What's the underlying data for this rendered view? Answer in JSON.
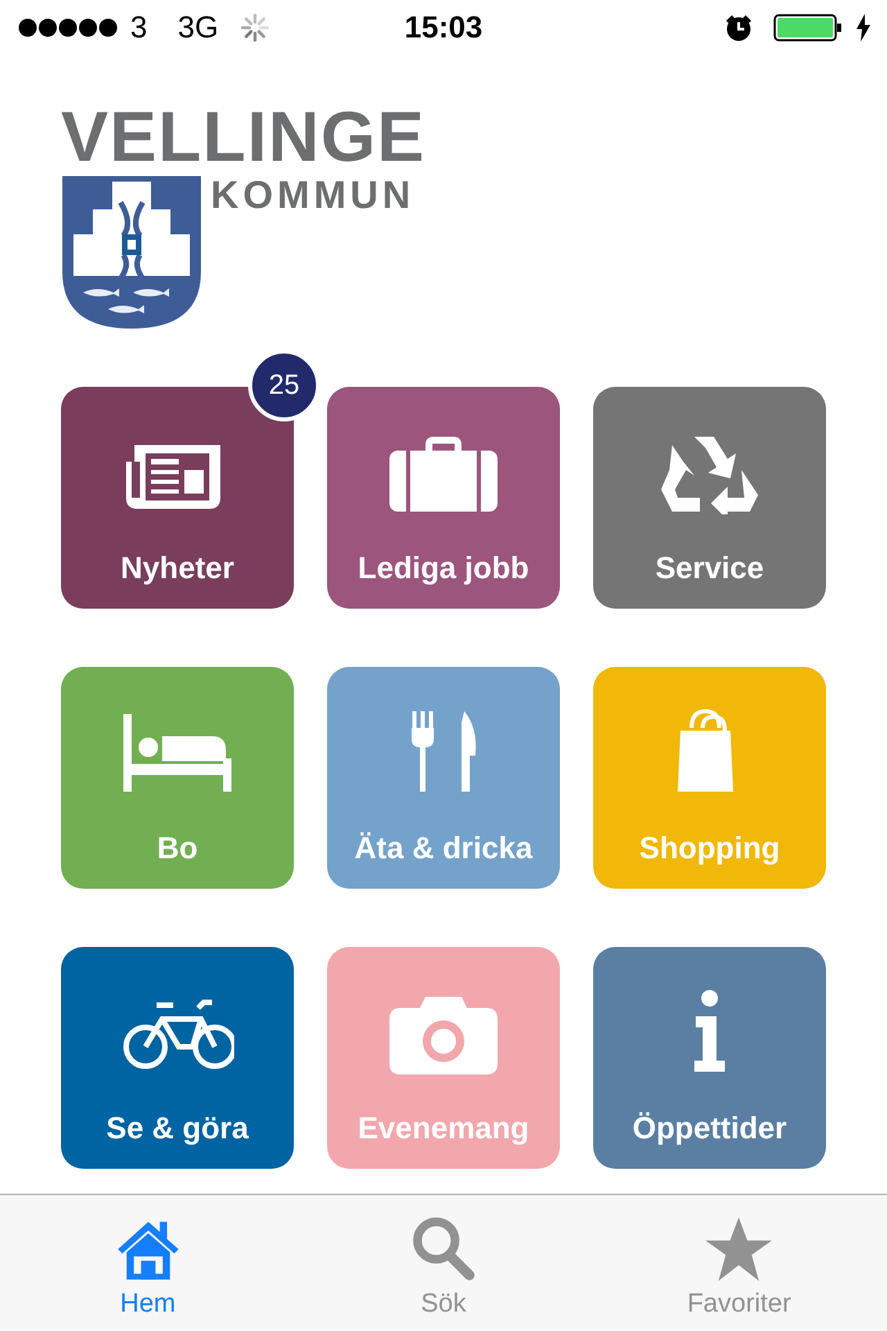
{
  "status_bar": {
    "carrier": "3",
    "network": "3G",
    "time": "15:03"
  },
  "logo": {
    "name": "VELLINGE",
    "subtitle": "KOMMUN"
  },
  "tiles": [
    {
      "label": "Nyheter",
      "kind": "newspaper",
      "color": "#7a3d5c",
      "badge": "25"
    },
    {
      "label": "Lediga jobb",
      "kind": "suitcase",
      "color": "#9c557c"
    },
    {
      "label": "Service",
      "kind": "recycle",
      "color": "#757575"
    },
    {
      "label": "Bo",
      "kind": "bed",
      "color": "#72af52"
    },
    {
      "label": "Äta & dricka",
      "kind": "cutlery",
      "color": "#74a2cb"
    },
    {
      "label": "Shopping",
      "kind": "bag",
      "color": "#f1b80a"
    },
    {
      "label": "Se & göra",
      "kind": "bicycle",
      "color": "#0063a2"
    },
    {
      "label": "Evenemang",
      "kind": "camera",
      "color": "#f2a7ac"
    },
    {
      "label": "Öppettider",
      "kind": "info",
      "color": "#5a7fa3"
    }
  ],
  "tab_bar": [
    {
      "label": "Hem",
      "kind": "home",
      "selected": true
    },
    {
      "label": "Sök",
      "kind": "search",
      "selected": false
    },
    {
      "label": "Favoriter",
      "kind": "star",
      "selected": false
    }
  ]
}
